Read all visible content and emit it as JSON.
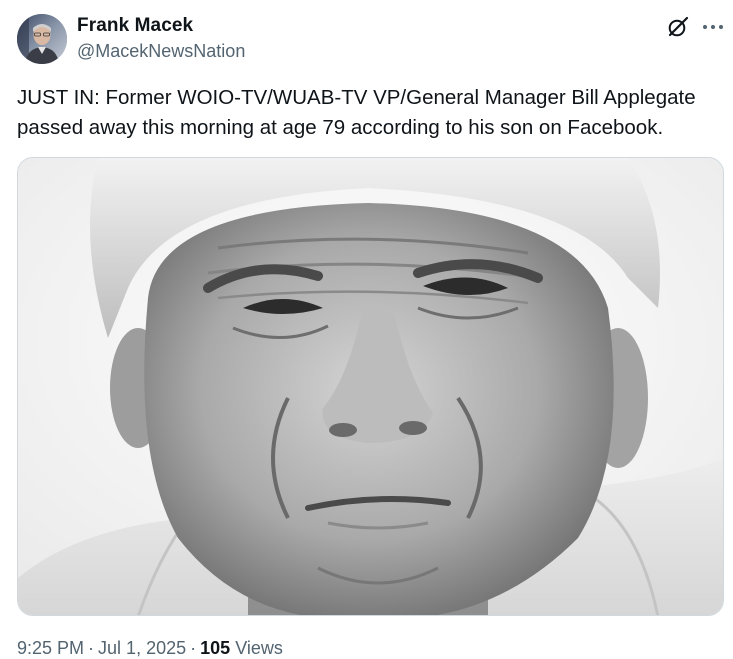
{
  "author": {
    "name": "Frank Macek",
    "handle": "@MacekNewsNation",
    "avatar_icon": "profile-photo"
  },
  "tweet": {
    "text": "JUST IN: Former WOIO-TV/WUAB-TV VP/General Manager Bill Applegate passed away this morning at age 79 according to his son on Facebook.",
    "media_alt": "Black and white close-up photo of an older man's face"
  },
  "actions": {
    "grok_icon": "grok-icon",
    "more_icon": "more-icon"
  },
  "meta": {
    "time": "9:25 PM",
    "date": "Jul 1, 2025",
    "separator": "·",
    "views_count": "105",
    "views_label": "Views"
  },
  "colors": {
    "primary_text": "#0f1419",
    "secondary_text": "#536471",
    "border": "#cfd9de"
  }
}
